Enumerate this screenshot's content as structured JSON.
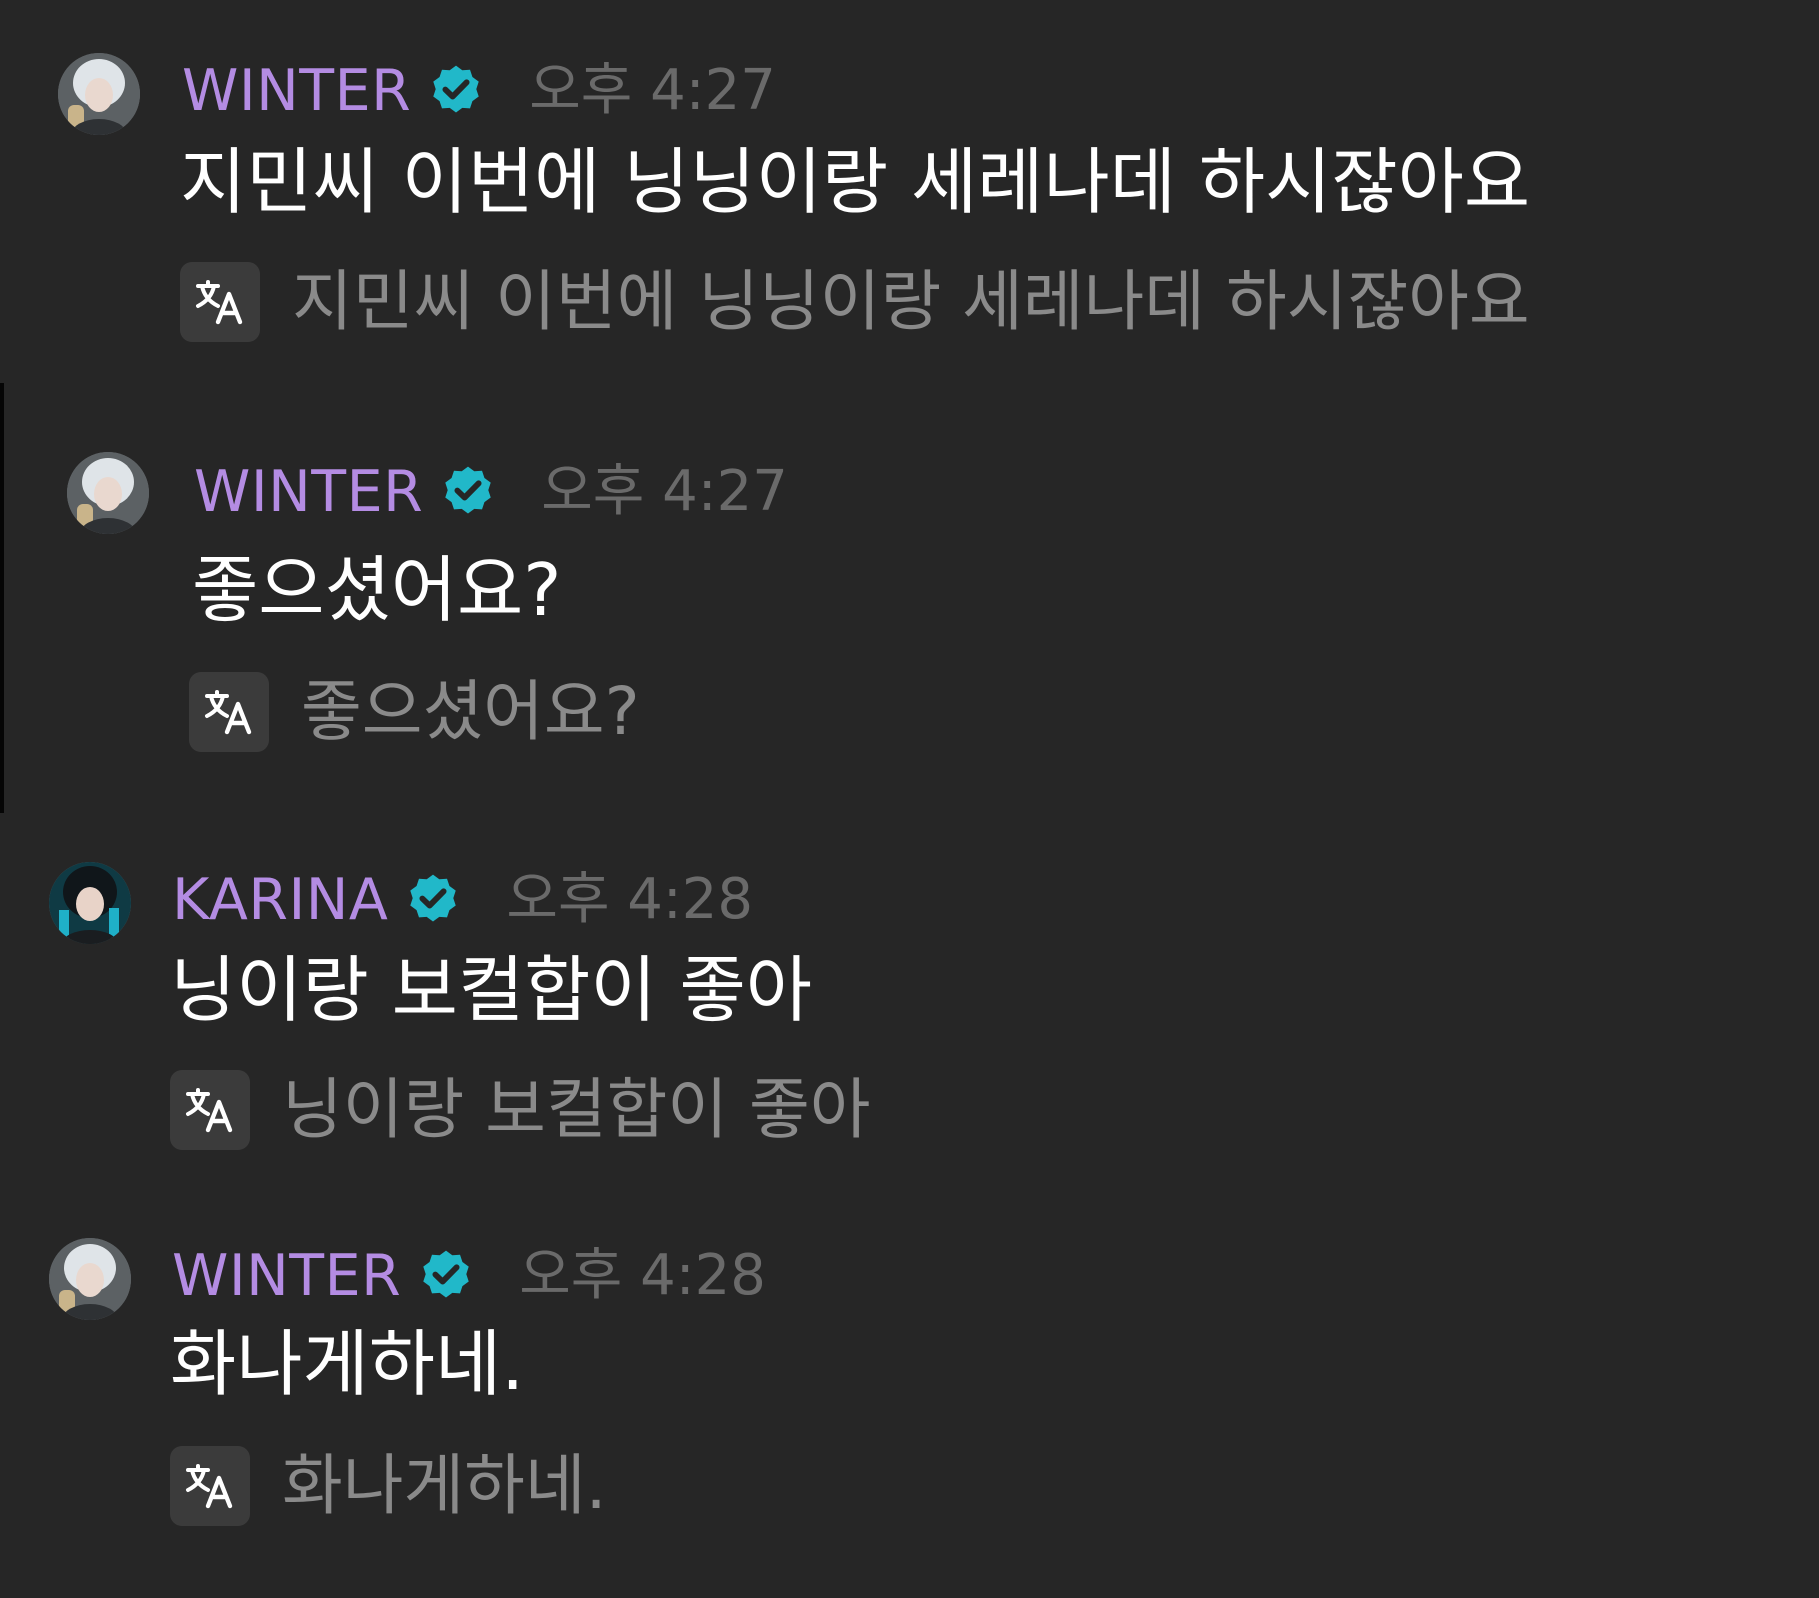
{
  "colors": {
    "background": "#262626",
    "username": "#b48ce3",
    "verified_badge": "#21b8c9",
    "timestamp": "#6a6a6a",
    "message_text": "#ffffff",
    "translation_text": "#8a8a8a",
    "translate_button": "#3b3b3b"
  },
  "icons": {
    "verified": "verified-badge-icon",
    "translate": "translate-icon"
  },
  "messages": [
    {
      "username": "WINTER",
      "verified": true,
      "time": "오후 4:27",
      "text": "지민씨 이번에 닝닝이랑 세레나데 하시잖아요",
      "translation": "지민씨 이번에 닝닝이랑 세레나데 하시잖아요"
    },
    {
      "username": "WINTER",
      "verified": true,
      "time": "오후 4:27",
      "text": "좋으셨어요?",
      "translation": "좋으셨어요?"
    },
    {
      "username": "KARINA",
      "verified": true,
      "time": "오후 4:28",
      "text": "닝이랑 보컬합이 좋아",
      "translation": "닝이랑 보컬합이 좋아"
    },
    {
      "username": "WINTER",
      "verified": true,
      "time": "오후 4:28",
      "text": "화나게하네.",
      "translation": "화나게하네."
    }
  ]
}
